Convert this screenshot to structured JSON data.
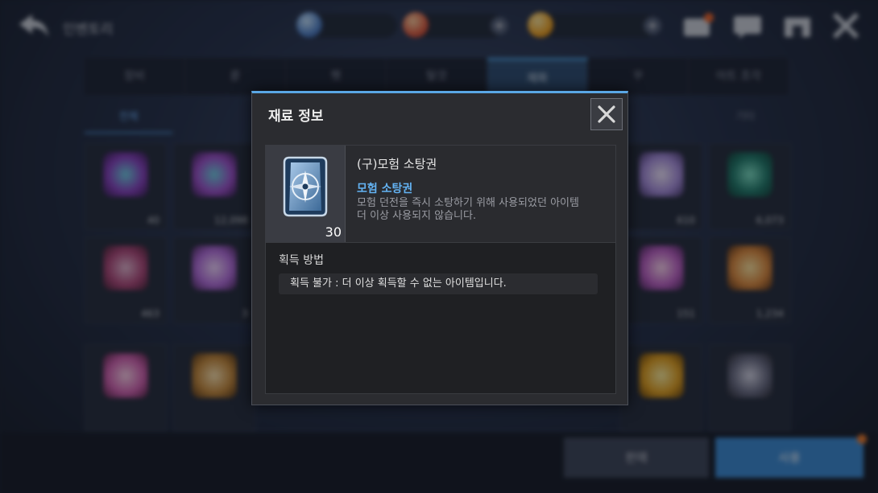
{
  "background": {
    "back_title": "인벤토리",
    "tabs": [
      "장비",
      "룬",
      "펫",
      "탈것",
      "재화",
      "꾸",
      "아트 조각"
    ],
    "active_tab_index": 4,
    "sub_tabs": [
      "전체",
      "",
      "",
      "",
      "",
      "",
      "",
      "기타"
    ],
    "quantities": [
      "40",
      "12,098",
      "",
      "",
      "",
      "",
      "610",
      "6,073",
      "463",
      "3",
      "",
      "",
      "",
      "",
      "151",
      "1,234"
    ],
    "sell_label": "판매",
    "use_label": "사용"
  },
  "modal": {
    "title": "재료 정보",
    "item_name": "(구)모험 소탕권",
    "item_category": "모험 소탕권",
    "item_description": "모험 던전을 즉시 소탕하기 위해 사용되었던 아이템\n더 이상 사용되지 않습니다.",
    "item_count": "30",
    "acquire_label": "획득 방법",
    "acquire_text": "획득 불가 : 더 이상 획득할 수 없는 아이템입니다."
  },
  "colors": {
    "accent": "#5aa7e5",
    "item_category": "#63b2f2",
    "use_button": "#3b8bd6"
  },
  "icons": [
    "back-arrow-icon",
    "mail-icon",
    "chat-icon",
    "shop-icon",
    "close-icon",
    "compass-ticket-icon"
  ]
}
